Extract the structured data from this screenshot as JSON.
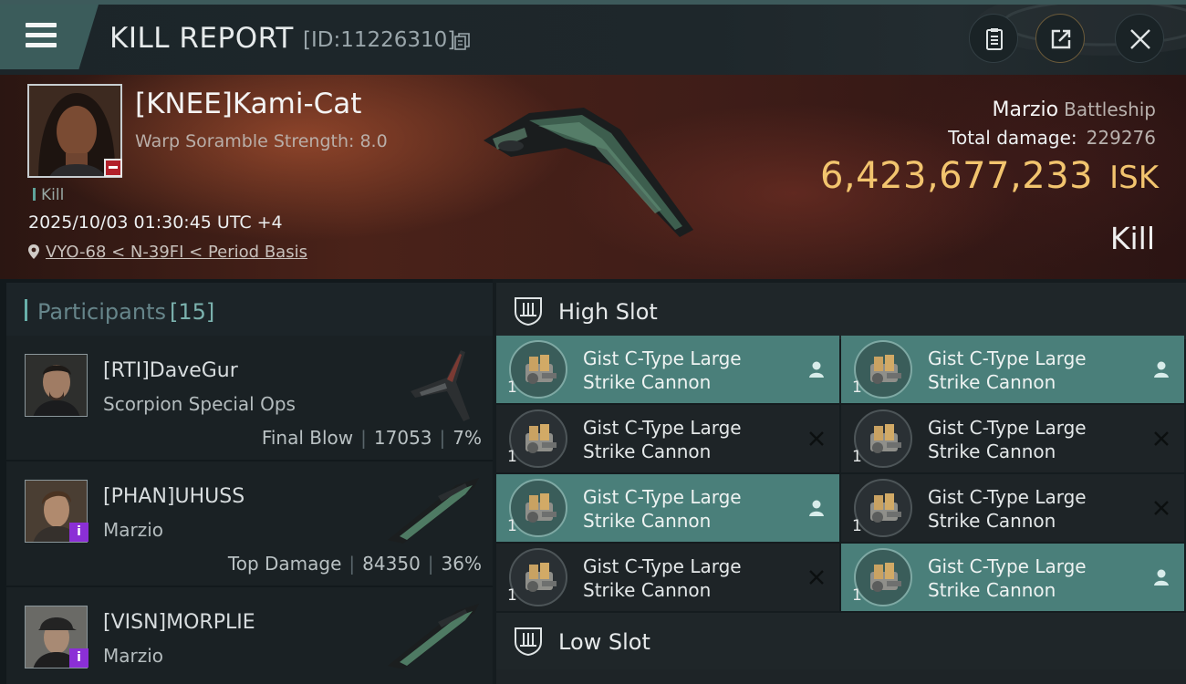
{
  "header": {
    "title": "KILL REPORT",
    "report_id": "[ID:11226310]",
    "icons": [
      "menu-icon",
      "copy-icon",
      "clipboard-icon",
      "share-icon",
      "close-icon"
    ]
  },
  "victim": {
    "name": "[KNEE]Kami-Cat",
    "warp_scramble": "Warp Soramble Strength: 8.0",
    "tag": "Kill",
    "datetime": "2025/10/03 01:30:45 UTC +4",
    "location": "VYO-68 < N-39FI < Period Basis",
    "ship_name": "Marzio",
    "ship_class": "Battleship",
    "total_damage_label": "Total damage:",
    "total_damage": "229276",
    "isk_value": "6,423,677,233",
    "isk_unit": "ISK",
    "result": "Kill"
  },
  "participants": {
    "title": "Participants",
    "count": "[15]",
    "rows": [
      {
        "name": "[RTI]DaveGur",
        "ship": "Scorpion Special Ops",
        "stat_label": "Final Blow",
        "damage": "17053",
        "percent": "7%"
      },
      {
        "name": "[PHAN]UHUSS",
        "ship": "Marzio",
        "stat_label": "Top Damage",
        "damage": "84350",
        "percent": "36%"
      },
      {
        "name": "[VISN]MORPLIE",
        "ship": "Marzio",
        "stat_label": "",
        "damage": "",
        "percent": ""
      }
    ]
  },
  "slots": {
    "high_label": "High Slot",
    "low_label": "Low Slot",
    "high_modules": [
      {
        "name_line1": "Gist C-Type Large",
        "name_line2": "Strike Cannon",
        "qty": "1",
        "status": "pilot-icon",
        "highlighted": true
      },
      {
        "name_line1": "Gist C-Type Large",
        "name_line2": "Strike Cannon",
        "qty": "1",
        "status": "pilot-icon",
        "highlighted": true
      },
      {
        "name_line1": "Gist C-Type Large",
        "name_line2": "Strike Cannon",
        "qty": "1",
        "status": "destroyed-x-icon",
        "highlighted": false
      },
      {
        "name_line1": "Gist C-Type Large",
        "name_line2": "Strike Cannon",
        "qty": "1",
        "status": "destroyed-x-icon",
        "highlighted": false
      },
      {
        "name_line1": "Gist C-Type Large",
        "name_line2": "Strike Cannon",
        "qty": "1",
        "status": "pilot-icon",
        "highlighted": true
      },
      {
        "name_line1": "Gist C-Type Large",
        "name_line2": "Strike Cannon",
        "qty": "1",
        "status": "destroyed-x-icon",
        "highlighted": false
      },
      {
        "name_line1": "Gist C-Type Large",
        "name_line2": "Strike Cannon",
        "qty": "1",
        "status": "destroyed-x-icon",
        "highlighted": false
      },
      {
        "name_line1": "Gist C-Type Large",
        "name_line2": "Strike Cannon",
        "qty": "1",
        "status": "pilot-icon",
        "highlighted": true
      }
    ]
  },
  "colors": {
    "accent_teal": "#4a7f7a",
    "isk_gold": "#f2c46e",
    "badge_red": "#b2202a",
    "badge_purple": "#8b2fd6"
  }
}
